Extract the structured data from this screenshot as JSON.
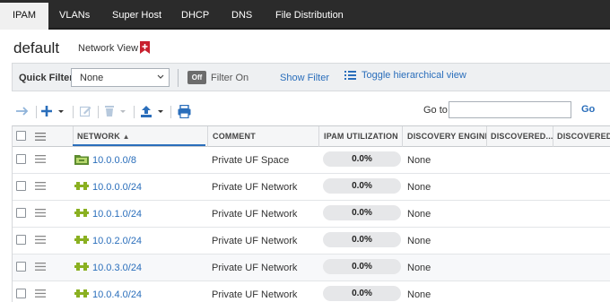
{
  "nav": {
    "tabs": [
      {
        "label": "IPAM",
        "active": true
      },
      {
        "label": "VLANs",
        "active": false
      },
      {
        "label": "Super Host",
        "active": false
      },
      {
        "label": "DHCP",
        "active": false
      },
      {
        "label": "DNS",
        "active": false
      },
      {
        "label": "File Distribution",
        "active": false
      }
    ]
  },
  "page": {
    "title": "default",
    "network_view_label": "Network View"
  },
  "filter": {
    "quick_filter_label": "Quick Filter",
    "quick_filter_value": "None",
    "toggle_label": "Off",
    "filter_on_label": "Filter On",
    "show_filter_label": "Show Filter",
    "toggle_hierarchical_label": "Toggle hierarchical view"
  },
  "toolbar": {
    "goto_label": "Go to",
    "goto_value": "",
    "go_label": "Go"
  },
  "grid": {
    "columns": [
      "NETWORK",
      "COMMENT",
      "IPAM UTILIZATION",
      "DISCOVERY ENGINE",
      "DISCOVERED...",
      "DISCOVERED V"
    ],
    "rows": [
      {
        "network": "10.0.0.0/8",
        "comment": "Private UF Space",
        "utilization": "0.0%",
        "discovery_engine": "None",
        "type": "container"
      },
      {
        "network": "10.0.0.0/24",
        "comment": "Private UF Network",
        "utilization": "0.0%",
        "discovery_engine": "None",
        "type": "network"
      },
      {
        "network": "10.0.1.0/24",
        "comment": "Private UF Network",
        "utilization": "0.0%",
        "discovery_engine": "None",
        "type": "network"
      },
      {
        "network": "10.0.2.0/24",
        "comment": "Private UF Network",
        "utilization": "0.0%",
        "discovery_engine": "None",
        "type": "network"
      },
      {
        "network": "10.0.3.0/24",
        "comment": "Private UF Network",
        "utilization": "0.0%",
        "discovery_engine": "None",
        "type": "network"
      },
      {
        "network": "10.0.4.0/24",
        "comment": "Private UF Network",
        "utilization": "0.0%",
        "discovery_engine": "None",
        "type": "network"
      }
    ]
  },
  "colors": {
    "nav_bg": "#2b2b2b",
    "link": "#2a6ebb",
    "bookmark": "#c8202e",
    "network_icon": "#8ab021"
  }
}
